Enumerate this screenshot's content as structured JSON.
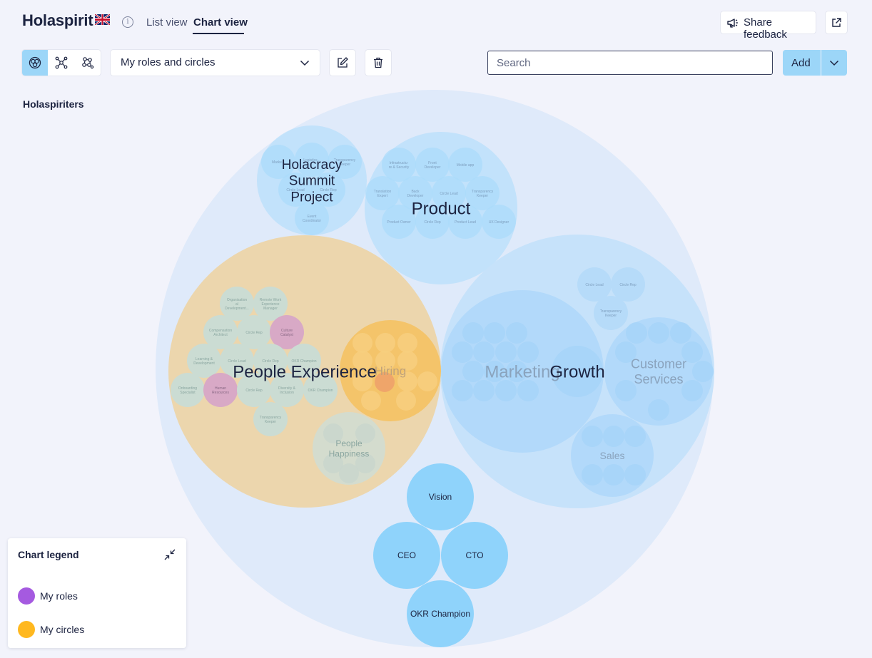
{
  "header": {
    "app_title": "Holaspirit",
    "flag_icon": "uk-flag-icon",
    "info_icon": "i",
    "tabs": [
      {
        "label": "List view",
        "active": false
      },
      {
        "label": "Chart view",
        "active": true
      }
    ],
    "share_feedback_label": "Share feedback",
    "share_icon": "megaphone-icon",
    "external_icon": "external-link-icon"
  },
  "toolbar": {
    "view_modes": [
      "circle-pack-view-icon",
      "network-view-icon",
      "cluster-view-icon"
    ],
    "active_view": 0,
    "filter_value": "My roles and circles",
    "edit_icon": "edit-icon",
    "delete_icon": "trash-icon",
    "search_placeholder": "Search",
    "add_label": "Add"
  },
  "org_label": "Holaspiriters",
  "legend": {
    "title": "Chart legend",
    "items": [
      {
        "label": "My roles",
        "color": "#a55ae0"
      },
      {
        "label": "My circles",
        "color": "#ffb81f"
      }
    ]
  },
  "colors": {
    "accent": "#9cd6f8",
    "circle_blue": "#a9dbfb",
    "my_circle": "#f7c35a",
    "my_role": "#c86fc0"
  },
  "chart": {
    "circles": [
      {
        "id": "root",
        "label": ""
      },
      {
        "id": "hsp",
        "label": "Holacracy\nSummit\nProject",
        "size": "xl"
      },
      {
        "id": "hsp1",
        "label": "Marke..."
      },
      {
        "id": "hsp2",
        "label": "Logistics..."
      },
      {
        "id": "hsp3",
        "label": "Transparency\nKeeper"
      },
      {
        "id": "hsp4",
        "label": "Circle Lead"
      },
      {
        "id": "hsp5",
        "label": "Circle Rep"
      },
      {
        "id": "hsp6",
        "label": "Event\nCoordinator"
      },
      {
        "id": "prod",
        "label": "Product",
        "size": "xl"
      },
      {
        "id": "p1",
        "label": "Infrastructu-\nre & Security"
      },
      {
        "id": "p2",
        "label": "Front\nDeveloper"
      },
      {
        "id": "p3",
        "label": "Mobile app"
      },
      {
        "id": "p4",
        "label": "Translation\nExpert"
      },
      {
        "id": "p5",
        "label": "Back\nDeveloper"
      },
      {
        "id": "p6",
        "label": "Circle Lead"
      },
      {
        "id": "p7",
        "label": "Transparency\nKeeper"
      },
      {
        "id": "p8",
        "label": "Product Owner"
      },
      {
        "id": "p9",
        "label": "Circle Rep"
      },
      {
        "id": "p10",
        "label": "Product Lead"
      },
      {
        "id": "p11",
        "label": "UX Designer"
      },
      {
        "id": "px",
        "label": "People Experience",
        "size": "xl"
      },
      {
        "id": "px1",
        "label": "Organisation\nal\nDevelopment..."
      },
      {
        "id": "px2",
        "label": "Remote Work\nExperience\nManager"
      },
      {
        "id": "px3",
        "label": "Compensation\nArchitect"
      },
      {
        "id": "px4",
        "label": "Circle Rep"
      },
      {
        "id": "px5",
        "label": "Culture\nCatalyst"
      },
      {
        "id": "px6",
        "label": "Learning &\nDevelopment"
      },
      {
        "id": "px7",
        "label": "Circle Lead"
      },
      {
        "id": "px8",
        "label": "Circle Rep"
      },
      {
        "id": "px9",
        "label": "OKR Champion"
      },
      {
        "id": "px10",
        "label": "Onboarding\nSpecialist"
      },
      {
        "id": "px11",
        "label": "Human\nResources"
      },
      {
        "id": "px12",
        "label": "Circle Rep"
      },
      {
        "id": "px13",
        "label": "Diversity &\nInclusion"
      },
      {
        "id": "px14",
        "label": "OKR Champion"
      },
      {
        "id": "px15",
        "label": "Transparency\nKeeper"
      },
      {
        "id": "hiring",
        "label": "Hiring",
        "size": "l"
      },
      {
        "id": "ph",
        "label": "People\nHappiness",
        "size": "l"
      },
      {
        "id": "growth",
        "label": "Growth",
        "size": "xl"
      },
      {
        "id": "g1",
        "label": "Circle Lead"
      },
      {
        "id": "g2",
        "label": "Circle Rep"
      },
      {
        "id": "g3",
        "label": "Transparency\nKeeper"
      },
      {
        "id": "mkt",
        "label": "Marketing",
        "size": "xl"
      },
      {
        "id": "cs",
        "label": "Customer\nServices",
        "size": "l"
      },
      {
        "id": "sales",
        "label": "Sales",
        "size": "l"
      },
      {
        "id": "vision",
        "label": "Vision",
        "size": "m"
      },
      {
        "id": "ceo",
        "label": "CEO",
        "size": "m"
      },
      {
        "id": "cto",
        "label": "CTO",
        "size": "m"
      },
      {
        "id": "okr",
        "label": "OKR Champion",
        "size": "m"
      }
    ]
  }
}
